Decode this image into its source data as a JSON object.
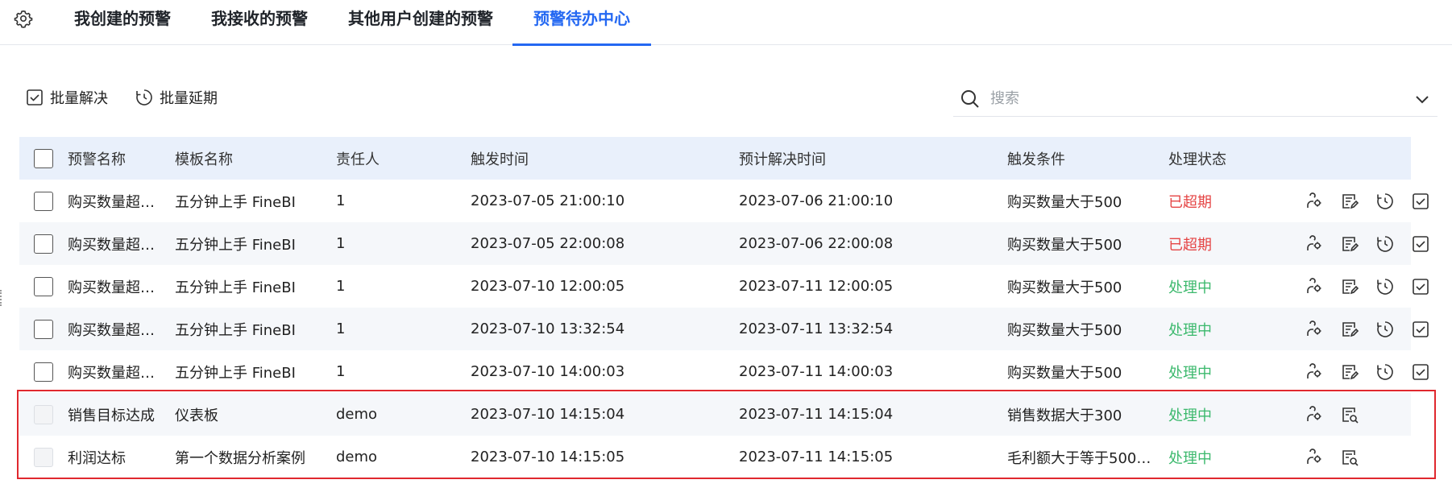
{
  "tabs": [
    {
      "label": "我创建的预警"
    },
    {
      "label": "我接收的预警"
    },
    {
      "label": "其他用户创建的预警"
    },
    {
      "label": "预警待办中心",
      "active": true
    }
  ],
  "toolbar": {
    "batch_resolve": "批量解决",
    "batch_extend": "批量延期"
  },
  "search": {
    "placeholder": "搜索",
    "value": ""
  },
  "table": {
    "columns": [
      "预警名称",
      "模板名称",
      "责任人",
      "触发时间",
      "预计解决时间",
      "触发条件",
      "处理状态"
    ],
    "rows": [
      {
        "name": "购买数量超…",
        "template": "五分钟上手 FineBI",
        "owner": "1",
        "trigger_time": "2023-07-05 21:00:10",
        "expected_time": "2023-07-06 21:00:10",
        "condition": "购买数量大于500",
        "status": "已超期"
      },
      {
        "name": "购买数量超…",
        "template": "五分钟上手 FineBI",
        "owner": "1",
        "trigger_time": "2023-07-05 22:00:08",
        "expected_time": "2023-07-06 22:00:08",
        "condition": "购买数量大于500",
        "status": "已超期"
      },
      {
        "name": "购买数量超…",
        "template": "五分钟上手 FineBI",
        "owner": "1",
        "trigger_time": "2023-07-10 12:00:05",
        "expected_time": "2023-07-11 12:00:05",
        "condition": "购买数量大于500",
        "status": "处理中"
      },
      {
        "name": "购买数量超…",
        "template": "五分钟上手 FineBI",
        "owner": "1",
        "trigger_time": "2023-07-10 13:32:54",
        "expected_time": "2023-07-11 13:32:54",
        "condition": "购买数量大于500",
        "status": "处理中"
      },
      {
        "name": "购买数量超…",
        "template": "五分钟上手 FineBI",
        "owner": "1",
        "trigger_time": "2023-07-10 14:00:03",
        "expected_time": "2023-07-11 14:00:03",
        "condition": "购买数量大于500",
        "status": "处理中"
      },
      {
        "name": "销售目标达成",
        "template": "仪表板",
        "owner": "demo",
        "trigger_time": "2023-07-10 14:15:04",
        "expected_time": "2023-07-11 14:15:04",
        "condition": "销售数据大于300",
        "status": "处理中"
      },
      {
        "name": "利润达标",
        "template": "第一个数据分析案例",
        "owner": "demo",
        "trigger_time": "2023-07-10 14:15:05",
        "expected_time": "2023-07-11 14:15:05",
        "condition": "毛利额大于等于500…",
        "status": "处理中"
      }
    ]
  },
  "colors": {
    "accent": "#2468f2",
    "overdue": "#e54545",
    "in_progress": "#3cb96d",
    "header_bg": "#e9f0fb",
    "highlight": "#e0282e"
  }
}
